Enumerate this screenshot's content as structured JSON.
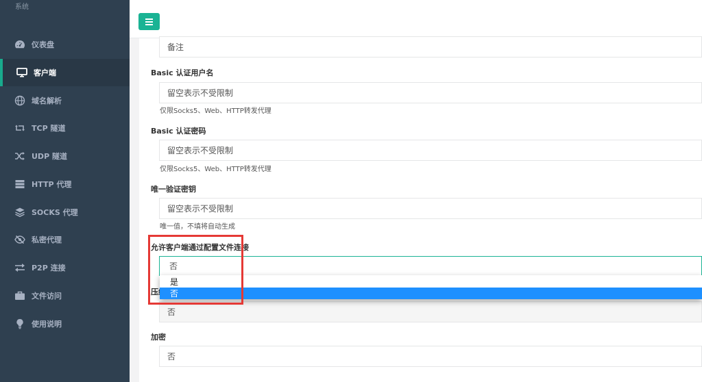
{
  "sidebar": {
    "system_label": "系统",
    "items": [
      {
        "label": "仪表盘",
        "icon": "dashboard-icon"
      },
      {
        "label": "客户端",
        "icon": "monitor-icon",
        "active": true
      },
      {
        "label": "域名解析",
        "icon": "globe-icon"
      },
      {
        "label": "TCP 隧道",
        "icon": "retweet-icon"
      },
      {
        "label": "UDP 隧道",
        "icon": "shuffle-icon"
      },
      {
        "label": "HTTP 代理",
        "icon": "server-icon"
      },
      {
        "label": "SOCKS 代理",
        "icon": "layers-icon"
      },
      {
        "label": "私密代理",
        "icon": "eye-slash-icon"
      },
      {
        "label": "P2P 连接",
        "icon": "exchange-icon"
      },
      {
        "label": "文件访问",
        "icon": "briefcase-icon"
      },
      {
        "label": "使用说明",
        "icon": "lightbulb-icon"
      }
    ]
  },
  "topbar": {
    "menu_icon": "hamburger-icon"
  },
  "colors": {
    "sidebar_bg": "#2f4050",
    "accent": "#1ab394",
    "highlight": "#1e90ff",
    "annotation": "#e53935"
  },
  "form": {
    "remark": {
      "value": "备注"
    },
    "basic_user": {
      "label": "Basic 认证用户名",
      "placeholder": "留空表示不受限制",
      "help": "仅限Socks5、Web、HTTP转发代理"
    },
    "basic_pass": {
      "label": "Basic 认证密码",
      "placeholder": "留空表示不受限制",
      "help": "仅限Socks5、Web、HTTP转发代理"
    },
    "unique_key": {
      "label": "唯一验证密钥",
      "placeholder": "留空表示不受限制",
      "help": "唯一值，不填将自动生成"
    },
    "config_conn": {
      "label": "允许客户端通过配置文件连接",
      "value": "否",
      "options": [
        "是",
        "否"
      ],
      "selected": "否"
    },
    "compress": {
      "label_partial": "压缩",
      "value": "否"
    },
    "encrypt": {
      "label": "加密",
      "value": "否"
    }
  }
}
